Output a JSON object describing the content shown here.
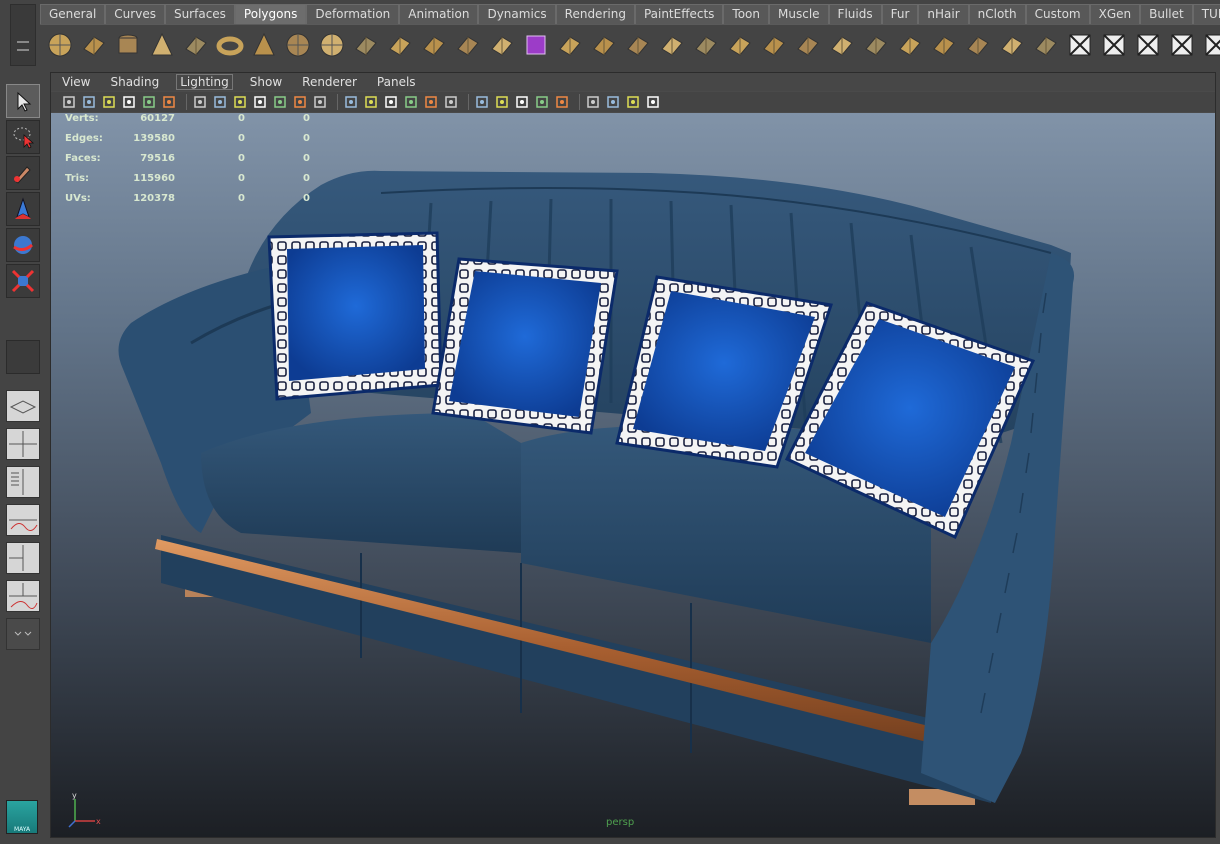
{
  "shelf": {
    "tabs": [
      "General",
      "Curves",
      "Surfaces",
      "Polygons",
      "Deformation",
      "Animation",
      "Dynamics",
      "Rendering",
      "PaintEffects",
      "Toon",
      "Muscle",
      "Fluids",
      "Fur",
      "nHair",
      "nCloth",
      "Custom",
      "XGen",
      "Bullet",
      "TURTLE"
    ],
    "active_tab": "Polygons",
    "icons": [
      "poly-sphere-icon",
      "poly-cube-icon",
      "poly-cylinder-icon",
      "poly-cone-icon",
      "poly-plane-icon",
      "poly-torus-icon",
      "poly-pyramid-icon",
      "poly-pipe-icon",
      "poly-soccer-ball-icon",
      "combine-icon",
      "separate-icon",
      "extract-icon",
      "smooth-icon",
      "mirror-geometry-icon",
      "boolean-icon",
      "extrude-icon",
      "bridge-icon",
      "append-polygon-icon",
      "fill-hole-icon",
      "cut-faces-icon",
      "split-polygon-icon",
      "insert-edge-loop-icon",
      "offset-edge-loop-icon",
      "subdivide-icon",
      "merge-icon",
      "bevel-icon",
      "poke-icon",
      "wedge-icon",
      "duplicate-face-icon",
      "sculpt-geometry-icon",
      "planar-mapping-icon",
      "cylindrical-mapping-icon",
      "spherical-mapping-icon",
      "automatic-mapping-icon",
      "uv-texture-editor-icon"
    ]
  },
  "viewport_panel": {
    "menu": [
      "View",
      "Shading",
      "Lighting",
      "Show",
      "Renderer",
      "Panels"
    ],
    "highlighted_menu": "Lighting",
    "toolbar_icons": [
      "select-camera-icon",
      "camera-attributes-icon",
      "bookmark-icon",
      "image-plane-icon",
      "2d-pan-zoom-icon",
      "grease-pencil-icon",
      "grid-icon",
      "film-gate-icon",
      "resolution-gate-icon",
      "gate-mask-icon",
      "field-chart-icon",
      "safe-action-icon",
      "safe-title-icon",
      "wireframe-icon",
      "smooth-shade-icon",
      "wireframe-on-shaded-icon",
      "xray-icon",
      "textured-icon",
      "use-all-lights-icon",
      "shadows-icon",
      "screen-space-ao-icon",
      "motion-blur-icon",
      "anti-aliasing-icon",
      "depth-of-field-icon",
      "isolate-select-icon",
      "xray-joints-icon",
      "xray-active-icon",
      "backface-culling-icon"
    ],
    "hud": {
      "rows": [
        {
          "label": "Verts:",
          "v1": "60127",
          "v2": "0",
          "v3": "0"
        },
        {
          "label": "Edges:",
          "v1": "139580",
          "v2": "0",
          "v3": "0"
        },
        {
          "label": "Faces:",
          "v1": "79516",
          "v2": "0",
          "v3": "0"
        },
        {
          "label": "Tris:",
          "v1": "115960",
          "v2": "0",
          "v3": "0"
        },
        {
          "label": "UVs:",
          "v1": "120378",
          "v2": "0",
          "v3": "0"
        }
      ]
    },
    "camera_name": "persp",
    "axis": {
      "x": "x",
      "y": "y"
    }
  },
  "toolbox": {
    "tools": [
      "select-tool-icon",
      "lasso-tool-icon",
      "paint-select-tool-icon",
      "move-tool-icon",
      "rotate-tool-icon",
      "scale-tool-icon",
      "last-tool-slot"
    ],
    "layouts": [
      "single-perspective-layout",
      "four-view-layout",
      "persp-outliner-layout",
      "persp-graph-layout",
      "hypershade-layout",
      "outliner-persp-graph-layout",
      "collapse-toggle"
    ]
  },
  "logo": "MAYA",
  "colors": {
    "sofa": "#2c5274",
    "sofa_dark": "#1d3a56",
    "pillow": "#1451b8",
    "trim": "#b26c3e",
    "hud_text": "#d8e8d0"
  }
}
